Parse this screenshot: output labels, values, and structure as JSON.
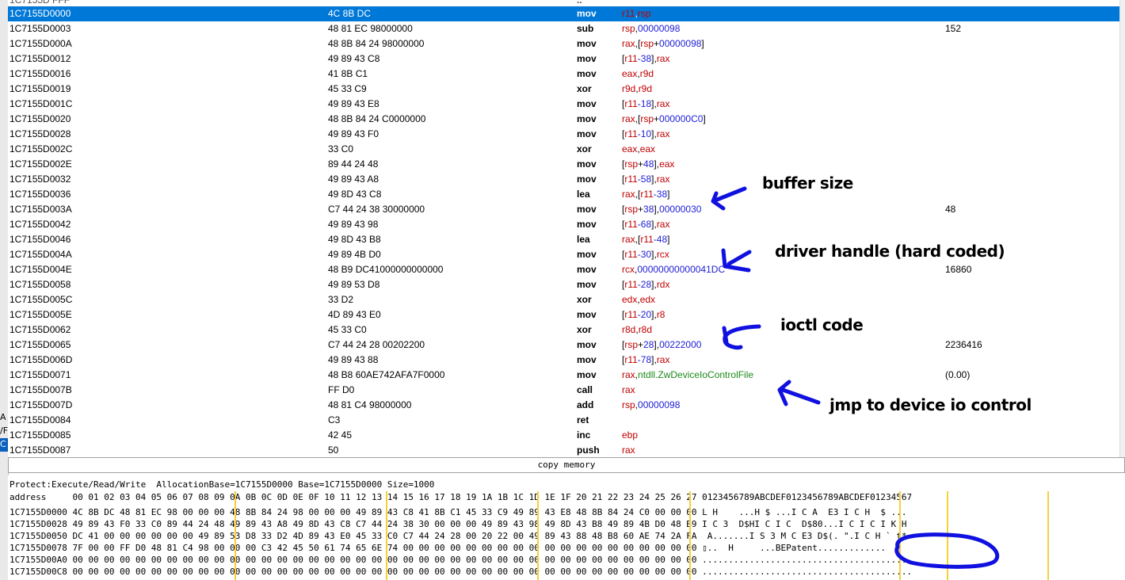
{
  "left_fragments": [
    "A",
    "/F",
    "C"
  ],
  "partial_row": {
    "addr": "1C7155D FFF",
    "bytes": "",
    "ops": ".."
  },
  "disasm": [
    {
      "addr": "1C7155D0000",
      "bytes": "4C 8B DC",
      "mn": "mov",
      "ops": [
        [
          "r11",
          "reg"
        ],
        [
          ",",
          "punc"
        ],
        [
          "rsp",
          "reg"
        ]
      ],
      "cm": "",
      "selected": true
    },
    {
      "addr": "1C7155D0003",
      "bytes": "48 81 EC 98000000",
      "mn": "sub",
      "ops": [
        [
          "rsp",
          "reg"
        ],
        [
          ",",
          "punc"
        ],
        [
          "00000098",
          "num"
        ]
      ],
      "cm": "152"
    },
    {
      "addr": "1C7155D000A",
      "bytes": "48 8B 84 24 98000000",
      "mn": "mov",
      "ops": [
        [
          "rax",
          "reg"
        ],
        [
          ",[",
          "punc"
        ],
        [
          "rsp",
          "reg"
        ],
        [
          "+",
          "punc"
        ],
        [
          "00000098",
          "num"
        ],
        [
          "]",
          "punc"
        ]
      ],
      "cm": ""
    },
    {
      "addr": "1C7155D0012",
      "bytes": "49 89 43 C8",
      "mn": "mov",
      "ops": [
        [
          "[",
          "punc"
        ],
        [
          "r11",
          "reg"
        ],
        [
          "-38",
          "num"
        ],
        [
          "],",
          "punc"
        ],
        [
          "rax",
          "reg"
        ]
      ],
      "cm": ""
    },
    {
      "addr": "1C7155D0016",
      "bytes": "41 8B C1",
      "mn": "mov",
      "ops": [
        [
          "eax",
          "reg"
        ],
        [
          ",",
          "punc"
        ],
        [
          "r9d",
          "reg"
        ]
      ],
      "cm": ""
    },
    {
      "addr": "1C7155D0019",
      "bytes": "45 33 C9",
      "mn": "xor",
      "ops": [
        [
          "r9d",
          "reg"
        ],
        [
          ",",
          "punc"
        ],
        [
          "r9d",
          "reg"
        ]
      ],
      "cm": ""
    },
    {
      "addr": "1C7155D001C",
      "bytes": "49 89 43 E8",
      "mn": "mov",
      "ops": [
        [
          "[",
          "punc"
        ],
        [
          "r11",
          "reg"
        ],
        [
          "-18",
          "num"
        ],
        [
          "],",
          "punc"
        ],
        [
          "rax",
          "reg"
        ]
      ],
      "cm": ""
    },
    {
      "addr": "1C7155D0020",
      "bytes": "48 8B 84 24 C0000000",
      "mn": "mov",
      "ops": [
        [
          "rax",
          "reg"
        ],
        [
          ",[",
          "punc"
        ],
        [
          "rsp",
          "reg"
        ],
        [
          "+",
          "punc"
        ],
        [
          "000000C0",
          "num"
        ],
        [
          "]",
          "punc"
        ]
      ],
      "cm": ""
    },
    {
      "addr": "1C7155D0028",
      "bytes": "49 89 43 F0",
      "mn": "mov",
      "ops": [
        [
          "[",
          "punc"
        ],
        [
          "r11",
          "reg"
        ],
        [
          "-10",
          "num"
        ],
        [
          "],",
          "punc"
        ],
        [
          "rax",
          "reg"
        ]
      ],
      "cm": ""
    },
    {
      "addr": "1C7155D002C",
      "bytes": "33 C0",
      "mn": "xor",
      "ops": [
        [
          "eax",
          "reg"
        ],
        [
          ",",
          "punc"
        ],
        [
          "eax",
          "reg"
        ]
      ],
      "cm": ""
    },
    {
      "addr": "1C7155D002E",
      "bytes": "89 44 24 48",
      "mn": "mov",
      "ops": [
        [
          "[",
          "punc"
        ],
        [
          "rsp",
          "reg"
        ],
        [
          "+",
          "punc"
        ],
        [
          "48",
          "num"
        ],
        [
          "],",
          "punc"
        ],
        [
          "eax",
          "reg"
        ]
      ],
      "cm": ""
    },
    {
      "addr": "1C7155D0032",
      "bytes": "49 89 43 A8",
      "mn": "mov",
      "ops": [
        [
          "[",
          "punc"
        ],
        [
          "r11",
          "reg"
        ],
        [
          "-58",
          "num"
        ],
        [
          "],",
          "punc"
        ],
        [
          "rax",
          "reg"
        ]
      ],
      "cm": ""
    },
    {
      "addr": "1C7155D0036",
      "bytes": "49 8D 43 C8",
      "mn": "lea",
      "ops": [
        [
          "rax",
          "reg"
        ],
        [
          ",[",
          "punc"
        ],
        [
          "r11",
          "reg"
        ],
        [
          "-38",
          "num"
        ],
        [
          "]",
          "punc"
        ]
      ],
      "cm": ""
    },
    {
      "addr": "1C7155D003A",
      "bytes": "C7 44 24 38 30000000",
      "mn": "mov",
      "ops": [
        [
          "[",
          "punc"
        ],
        [
          "rsp",
          "reg"
        ],
        [
          "+",
          "punc"
        ],
        [
          "38",
          "num"
        ],
        [
          "],",
          "punc"
        ],
        [
          "00000030",
          "num"
        ]
      ],
      "cm": "48"
    },
    {
      "addr": "1C7155D0042",
      "bytes": "49 89 43 98",
      "mn": "mov",
      "ops": [
        [
          "[",
          "punc"
        ],
        [
          "r11",
          "reg"
        ],
        [
          "-68",
          "num"
        ],
        [
          "],",
          "punc"
        ],
        [
          "rax",
          "reg"
        ]
      ],
      "cm": ""
    },
    {
      "addr": "1C7155D0046",
      "bytes": "49 8D 43 B8",
      "mn": "lea",
      "ops": [
        [
          "rax",
          "reg"
        ],
        [
          ",[",
          "punc"
        ],
        [
          "r11",
          "reg"
        ],
        [
          "-48",
          "num"
        ],
        [
          "]",
          "punc"
        ]
      ],
      "cm": ""
    },
    {
      "addr": "1C7155D004A",
      "bytes": "49 89 4B D0",
      "mn": "mov",
      "ops": [
        [
          "[",
          "punc"
        ],
        [
          "r11",
          "reg"
        ],
        [
          "-30",
          "num"
        ],
        [
          "],",
          "punc"
        ],
        [
          "rcx",
          "reg"
        ]
      ],
      "cm": ""
    },
    {
      "addr": "1C7155D004E",
      "bytes": "48 B9 DC41000000000000",
      "mn": "mov",
      "ops": [
        [
          "rcx",
          "reg"
        ],
        [
          ",",
          "punc"
        ],
        [
          "00000000000041DC",
          "num"
        ]
      ],
      "cm": "16860"
    },
    {
      "addr": "1C7155D0058",
      "bytes": "49 89 53 D8",
      "mn": "mov",
      "ops": [
        [
          "[",
          "punc"
        ],
        [
          "r11",
          "reg"
        ],
        [
          "-28",
          "num"
        ],
        [
          "],",
          "punc"
        ],
        [
          "rdx",
          "reg"
        ]
      ],
      "cm": ""
    },
    {
      "addr": "1C7155D005C",
      "bytes": "33 D2",
      "mn": "xor",
      "ops": [
        [
          "edx",
          "reg"
        ],
        [
          ",",
          "punc"
        ],
        [
          "edx",
          "reg"
        ]
      ],
      "cm": ""
    },
    {
      "addr": "1C7155D005E",
      "bytes": "4D 89 43 E0",
      "mn": "mov",
      "ops": [
        [
          "[",
          "punc"
        ],
        [
          "r11",
          "reg"
        ],
        [
          "-20",
          "num"
        ],
        [
          "],",
          "punc"
        ],
        [
          "r8",
          "reg"
        ]
      ],
      "cm": ""
    },
    {
      "addr": "1C7155D0062",
      "bytes": "45 33 C0",
      "mn": "xor",
      "ops": [
        [
          "r8d",
          "reg"
        ],
        [
          ",",
          "punc"
        ],
        [
          "r8d",
          "reg"
        ]
      ],
      "cm": ""
    },
    {
      "addr": "1C7155D0065",
      "bytes": "C7 44 24 28 00202200",
      "mn": "mov",
      "ops": [
        [
          "[",
          "punc"
        ],
        [
          "rsp",
          "reg"
        ],
        [
          "+",
          "punc"
        ],
        [
          "28",
          "num"
        ],
        [
          "],",
          "punc"
        ],
        [
          "00222000",
          "num"
        ]
      ],
      "cm": "2236416"
    },
    {
      "addr": "1C7155D006D",
      "bytes": "49 89 43 88",
      "mn": "mov",
      "ops": [
        [
          "[",
          "punc"
        ],
        [
          "r11",
          "reg"
        ],
        [
          "-78",
          "num"
        ],
        [
          "],",
          "punc"
        ],
        [
          "rax",
          "reg"
        ]
      ],
      "cm": ""
    },
    {
      "addr": "1C7155D0071",
      "bytes": "48 B8 60AE742AFA7F0000",
      "mn": "mov",
      "ops": [
        [
          "rax",
          "reg"
        ],
        [
          ",",
          "punc"
        ],
        [
          "ntdll.ZwDeviceIoControlFile",
          "sym"
        ]
      ],
      "cm": "(0.00)"
    },
    {
      "addr": "1C7155D007B",
      "bytes": "FF D0",
      "mn": "call",
      "ops": [
        [
          "rax",
          "reg"
        ]
      ],
      "cm": ""
    },
    {
      "addr": "1C7155D007D",
      "bytes": "48 81 C4 98000000",
      "mn": "add",
      "ops": [
        [
          "rsp",
          "reg"
        ],
        [
          ",",
          "punc"
        ],
        [
          "00000098",
          "num"
        ]
      ],
      "cm": ""
    },
    {
      "addr": "1C7155D0084",
      "bytes": "C3",
      "mn": "ret",
      "ops": [],
      "cm": ""
    },
    {
      "addr": "1C7155D0085",
      "bytes": "42 45",
      "mn": "inc",
      "ops": [
        [
          "ebp",
          "reg"
        ]
      ],
      "cm": ""
    },
    {
      "addr": "1C7155D0087",
      "bytes": "50",
      "mn": "push",
      "ops": [
        [
          "rax",
          "reg"
        ]
      ],
      "cm": ""
    }
  ],
  "status": {
    "text": "copy memory"
  },
  "hex": {
    "info": "Protect:Execute/Read/Write  AllocationBase=1C7155D0000 Base=1C7155D0000 Size=1000",
    "header": "address     00 01 02 03 04 05 06 07 08 09 0A 0B 0C 0D 0E 0F 10 11 12 13 14 15 16 17 18 19 1A 1B 1C 1D 1E 1F 20 21 22 23 24 25 26 27 0123456789ABCDEF0123456789ABCDEF01234567",
    "rows": [
      "1C7155D0000 4C 8B DC 48 81 EC 98 00 00 00 48 8B 84 24 98 00 00 00 49 89 43 C8 41 8B C1 45 33 C9 49 89 43 E8 48 8B 84 24 C0 00 00 00 L H    ...H $ ...I C A  E3 I C H  $ ...",
      "1C7155D0028 49 89 43 F0 33 C0 89 44 24 48 49 89 43 A8 49 8D 43 C8 C7 44 24 38 30 00 00 00 49 89 43 98 49 8D 43 B8 49 89 4B D0 48 B9 I C 3  D$HI C I C  D$80...I C I C I K H",
      "1C7155D0050 DC 41 00 00 00 00 00 00 49 89 53 D8 33 D2 4D 89 43 E0 45 33 C0 C7 44 24 28 00 20 22 00 49 89 43 88 48 B8 60 AE 74 2A FA  A.......I S 3 M C E3 D$(. \".I C H ` t*",
      "1C7155D0078 7F 00 00 FF D0 48 81 C4 98 00 00 00 C3 42 45 50 61 74 65 6E 74 00 00 00 00 00 00 00 00 00 00 00 00 00 00 00 00 00 00 00 ▯..  H     ...BEPatent.............",
      "1C7155D00A0 00 00 00 00 00 00 00 00 00 00 00 00 00 00 00 00 00 00 00 00 00 00 00 00 00 00 00 00 00 00 00 00 00 00 00 00 00 00 00 00 ........................................",
      "1C7155D00C8 00 00 00 00 00 00 00 00 00 00 00 00 00 00 00 00 00 00 00 00 00 00 00 00 00 00 00 00 00 00 00 00 00 00 00 00 00 00 00 00 ........................................"
    ]
  },
  "annotations": {
    "buffer_size": "buffer size",
    "driver_handle": "driver handle (hard coded)",
    "ioctl": "ioctl code",
    "jmp": "jmp to device io control"
  },
  "colors": {
    "selection": "#0078d7",
    "register": "#c00000",
    "number": "#1d1dd6",
    "symbol": "#1a8a1a",
    "ink": "#1010e0"
  }
}
